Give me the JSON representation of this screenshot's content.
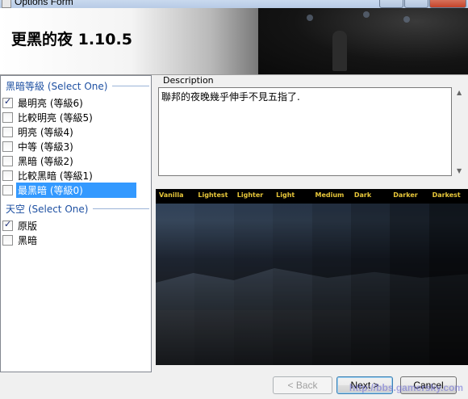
{
  "window": {
    "title": "Options Form"
  },
  "banner": {
    "title": "更黑的夜 1.10.5"
  },
  "groups": [
    {
      "header": "黑暗等級 (Select One)",
      "options": [
        {
          "label": "最明亮 (等級6)",
          "checked": true,
          "selected": false
        },
        {
          "label": "比較明亮 (等級5)",
          "checked": false,
          "selected": false
        },
        {
          "label": "明亮 (等級4)",
          "checked": false,
          "selected": false
        },
        {
          "label": "中等 (等級3)",
          "checked": false,
          "selected": false
        },
        {
          "label": "黑暗 (等級2)",
          "checked": false,
          "selected": false
        },
        {
          "label": "比較黑暗 (等級1)",
          "checked": false,
          "selected": false
        },
        {
          "label": "最黑暗 (等級0)",
          "checked": false,
          "selected": true
        }
      ]
    },
    {
      "header": "天空 (Select One)",
      "options": [
        {
          "label": "原版",
          "checked": true,
          "selected": false
        },
        {
          "label": "黑暗",
          "checked": false,
          "selected": false
        }
      ]
    }
  ],
  "description": {
    "label": "Description",
    "text": "聯邦的夜晚幾乎伸手不見五指了."
  },
  "preview": {
    "columns": [
      "Vanilla",
      "Lightest",
      "Lighter",
      "Light",
      "Medium",
      "Dark",
      "Darker",
      "Darkest"
    ],
    "column_darkness": [
      0.0,
      0.05,
      0.12,
      0.2,
      0.3,
      0.42,
      0.55,
      0.68
    ]
  },
  "buttons": {
    "back": "< Back",
    "next": "Next >",
    "cancel": "Cancel"
  },
  "watermark": "http://bbs.gamersky.com",
  "colors": {
    "group_header": "#1e50a2",
    "selection": "#3399ff",
    "preview_header_text": "#e8c73a"
  }
}
